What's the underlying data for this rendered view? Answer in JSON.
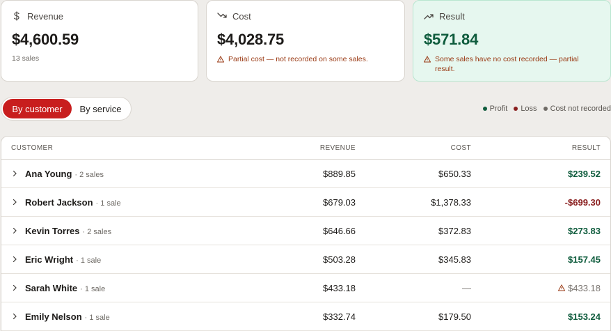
{
  "summary": {
    "revenue": {
      "label": "Revenue",
      "value": "$4,600.59",
      "sub": "13 sales",
      "icon": "dollar-icon"
    },
    "cost": {
      "label": "Cost",
      "value": "$4,028.75",
      "warning": "Partial cost — not recorded on some sales.",
      "icon": "trending-down-icon"
    },
    "result": {
      "label": "Result",
      "value": "$571.84",
      "warning": "Some sales have no cost recorded — partial result.",
      "icon": "trending-up-icon"
    }
  },
  "toggle": {
    "by_customer": "By customer",
    "by_service": "By service",
    "active": "by_customer"
  },
  "legend": {
    "profit": "Profit",
    "loss": "Loss",
    "no_cost": "Cost not recorded",
    "colors": {
      "profit": "#0f5c3d",
      "loss": "#8a1f1f",
      "no_cost": "#6e6a65"
    }
  },
  "table": {
    "headers": {
      "customer": "CUSTOMER",
      "revenue": "REVENUE",
      "cost": "COST",
      "result": "RESULT"
    },
    "rows": [
      {
        "name": "Ana Young",
        "sales": "· 2 sales",
        "revenue": "$889.85",
        "cost": "$650.33",
        "result": "$239.52",
        "status": "profit"
      },
      {
        "name": "Robert Jackson",
        "sales": "· 1 sale",
        "revenue": "$679.03",
        "cost": "$1,378.33",
        "result": "-$699.30",
        "status": "loss"
      },
      {
        "name": "Kevin Torres",
        "sales": "· 2 sales",
        "revenue": "$646.66",
        "cost": "$372.83",
        "result": "$273.83",
        "status": "profit"
      },
      {
        "name": "Eric Wright",
        "sales": "· 1 sale",
        "revenue": "$503.28",
        "cost": "$345.83",
        "result": "$157.45",
        "status": "profit"
      },
      {
        "name": "Sarah White",
        "sales": "· 1 sale",
        "revenue": "$433.18",
        "cost": "—",
        "result": "$433.18",
        "status": "no_cost"
      },
      {
        "name": "Emily Nelson",
        "sales": "· 1 sale",
        "revenue": "$332.74",
        "cost": "$179.50",
        "result": "$153.24",
        "status": "profit"
      }
    ]
  }
}
